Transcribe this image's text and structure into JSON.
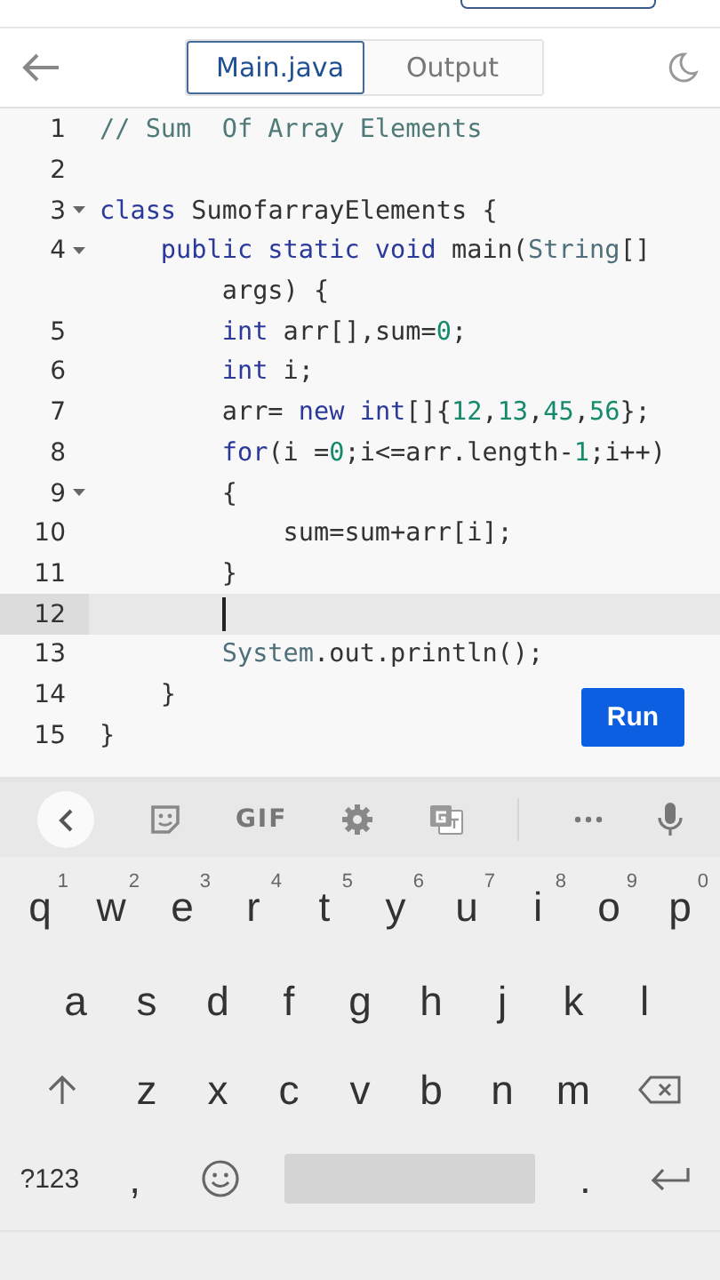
{
  "header": {
    "tabs": [
      {
        "label": "Main.java",
        "selected": true
      },
      {
        "label": "Output",
        "selected": false
      }
    ]
  },
  "editor": {
    "lines": [
      {
        "number": "1",
        "fold": false,
        "current": false,
        "tokens": [
          {
            "kind": "comment",
            "text": "// Sum  Of Array Elements"
          }
        ]
      },
      {
        "number": "2",
        "fold": false,
        "current": false
      },
      {
        "number": "3",
        "fold": true,
        "current": false,
        "tokens": [
          {
            "kind": "keyword",
            "text": "class"
          },
          {
            "kind": "plain",
            "text": " SumofarrayElements {"
          }
        ]
      },
      {
        "number": "4",
        "fold": true,
        "current": false,
        "tokens": [
          {
            "kind": "keyword",
            "text": "    public static void"
          },
          {
            "kind": "plain",
            "text": " main("
          },
          {
            "kind": "type",
            "text": "String"
          },
          {
            "kind": "plain",
            "text": "[]"
          }
        ]
      },
      {
        "fold": false,
        "current": false,
        "tokens": [
          {
            "kind": "plain",
            "text": "        args) {"
          }
        ]
      },
      {
        "number": "5",
        "fold": false,
        "current": false,
        "tokens": [
          {
            "kind": "keyword",
            "text": "        int"
          },
          {
            "kind": "plain",
            "text": " arr[],sum="
          },
          {
            "kind": "number",
            "text": "0"
          },
          {
            "kind": "plain",
            "text": ";"
          }
        ]
      },
      {
        "number": "6",
        "fold": false,
        "current": false,
        "tokens": [
          {
            "kind": "keyword",
            "text": "        int"
          },
          {
            "kind": "plain",
            "text": " i;"
          }
        ]
      },
      {
        "number": "7",
        "fold": false,
        "current": false,
        "tokens": [
          {
            "kind": "plain",
            "text": "        arr= "
          },
          {
            "kind": "keyword",
            "text": "new int"
          },
          {
            "kind": "plain",
            "text": "[]{"
          },
          {
            "kind": "number",
            "text": "12"
          },
          {
            "kind": "plain",
            "text": ","
          },
          {
            "kind": "number",
            "text": "13"
          },
          {
            "kind": "plain",
            "text": ","
          },
          {
            "kind": "number",
            "text": "45"
          },
          {
            "kind": "plain",
            "text": ","
          },
          {
            "kind": "number",
            "text": "56"
          },
          {
            "kind": "plain",
            "text": "};"
          }
        ]
      },
      {
        "number": "8",
        "fold": false,
        "current": false,
        "tokens": [
          {
            "kind": "keyword",
            "text": "        for"
          },
          {
            "kind": "plain",
            "text": "(i ="
          },
          {
            "kind": "number",
            "text": "0"
          },
          {
            "kind": "plain",
            "text": ";i<=arr.length-"
          },
          {
            "kind": "number",
            "text": "1"
          },
          {
            "kind": "plain",
            "text": ";i++)"
          }
        ]
      },
      {
        "number": "9",
        "fold": true,
        "current": false,
        "tokens": [
          {
            "kind": "plain",
            "text": "        {"
          }
        ]
      },
      {
        "number": "10",
        "fold": false,
        "current": false,
        "tokens": [
          {
            "kind": "plain",
            "text": "            sum=sum+arr[i];"
          }
        ]
      },
      {
        "number": "11",
        "fold": false,
        "current": false,
        "tokens": [
          {
            "kind": "plain",
            "text": "        }"
          }
        ]
      },
      {
        "number": "12",
        "fold": false,
        "current": true
      },
      {
        "number": "13",
        "fold": false,
        "current": false,
        "tokens": [
          {
            "kind": "type",
            "text": "        System"
          },
          {
            "kind": "plain",
            "text": ".out.println();"
          }
        ]
      },
      {
        "number": "14",
        "fold": false,
        "current": false,
        "tokens": [
          {
            "kind": "plain",
            "text": "    }"
          }
        ]
      },
      {
        "number": "15",
        "fold": false,
        "current": false,
        "tokens": [
          {
            "kind": "plain",
            "text": "}"
          }
        ]
      }
    ],
    "run_button": "Run"
  },
  "keyboard": {
    "toolbar": [
      "GIF"
    ],
    "rows": [
      [
        {
          "kind": "char",
          "label": "q",
          "hint": "1"
        },
        {
          "kind": "char",
          "label": "w",
          "hint": "2"
        },
        {
          "kind": "char",
          "label": "e",
          "hint": "3"
        },
        {
          "kind": "char",
          "label": "r",
          "hint": "4"
        },
        {
          "kind": "char",
          "label": "t",
          "hint": "5"
        },
        {
          "kind": "char",
          "label": "y",
          "hint": "6"
        },
        {
          "kind": "char",
          "label": "u",
          "hint": "7"
        },
        {
          "kind": "char",
          "label": "i",
          "hint": "8"
        },
        {
          "kind": "char",
          "label": "o",
          "hint": "9"
        },
        {
          "kind": "char",
          "label": "p",
          "hint": "0"
        }
      ],
      [
        {
          "kind": "char",
          "label": "a"
        },
        {
          "kind": "char",
          "label": "s"
        },
        {
          "kind": "char",
          "label": "d"
        },
        {
          "kind": "char",
          "label": "f"
        },
        {
          "kind": "char",
          "label": "g"
        },
        {
          "kind": "char",
          "label": "h"
        },
        {
          "kind": "char",
          "label": "j"
        },
        {
          "kind": "char",
          "label": "k"
        },
        {
          "kind": "char",
          "label": "l"
        }
      ],
      [
        {
          "kind": "shift"
        },
        {
          "kind": "char",
          "label": "z"
        },
        {
          "kind": "char",
          "label": "x"
        },
        {
          "kind": "char",
          "label": "c"
        },
        {
          "kind": "char",
          "label": "v"
        },
        {
          "kind": "char",
          "label": "b"
        },
        {
          "kind": "char",
          "label": "n"
        },
        {
          "kind": "char",
          "label": "m"
        },
        {
          "kind": "backspace"
        }
      ],
      [
        {
          "kind": "symbols",
          "label": "?123"
        },
        {
          "kind": "char",
          "label": ","
        },
        {
          "kind": "emoji"
        },
        {
          "kind": "space"
        },
        {
          "kind": "char",
          "label": "."
        },
        {
          "kind": "enter"
        }
      ]
    ]
  }
}
